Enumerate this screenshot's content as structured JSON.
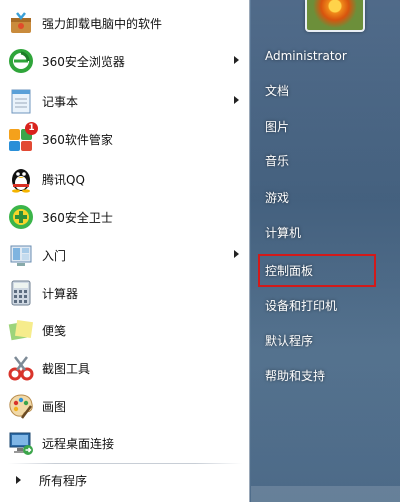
{
  "programs": [
    {
      "label": "强力卸载电脑中的软件",
      "icon": "uninstall-box-icon",
      "has_submenu": false
    },
    {
      "label": "360安全浏览器",
      "icon": "360-browser-icon",
      "has_submenu": true
    },
    {
      "label": "记事本",
      "icon": "notepad-icon",
      "has_submenu": true
    },
    {
      "label": "360软件管家",
      "icon": "360-software-manager-icon",
      "has_submenu": false,
      "badge": "1"
    },
    {
      "label": "腾讯QQ",
      "icon": "qq-penguin-icon",
      "has_submenu": false
    },
    {
      "label": "360安全卫士",
      "icon": "360-security-guard-icon",
      "has_submenu": false
    },
    {
      "label": "入门",
      "icon": "getting-started-icon",
      "has_submenu": true
    },
    {
      "label": "计算器",
      "icon": "calculator-icon",
      "has_submenu": false
    },
    {
      "label": "便笺",
      "icon": "sticky-notes-icon",
      "has_submenu": false
    },
    {
      "label": "截图工具",
      "icon": "snipping-tool-icon",
      "has_submenu": false
    },
    {
      "label": "画图",
      "icon": "paint-palette-icon",
      "has_submenu": false
    },
    {
      "label": "远程桌面连接",
      "icon": "remote-desktop-icon",
      "has_submenu": false
    }
  ],
  "all_programs": "所有程序",
  "places": [
    {
      "label": "Administrator"
    },
    {
      "label": "文档"
    },
    {
      "label": "图片"
    },
    {
      "label": "音乐"
    },
    {
      "label": "游戏"
    },
    {
      "label": "计算机"
    },
    {
      "label": "控制面板"
    },
    {
      "label": "设备和打印机"
    },
    {
      "label": "默认程序"
    },
    {
      "label": "帮助和支持"
    }
  ],
  "highlighted_item": "控制面板",
  "colors": {
    "highlight_border": "#d21a1a",
    "right_text": "#ffffff"
  }
}
